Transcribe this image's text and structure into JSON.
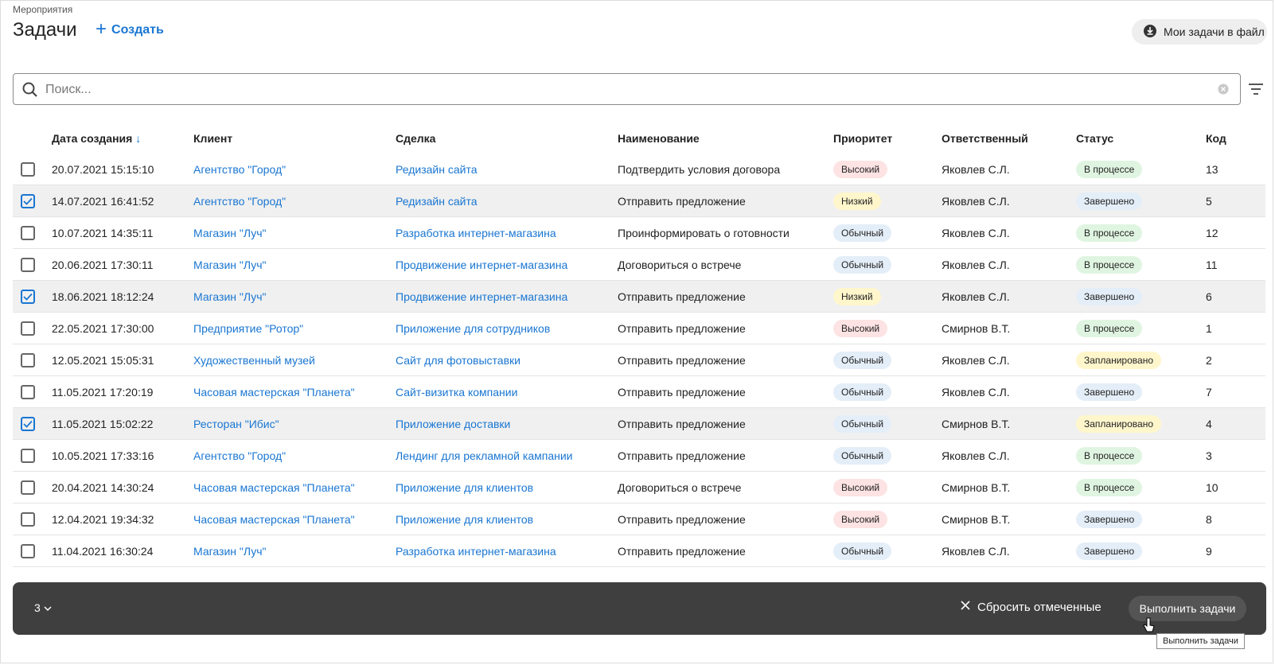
{
  "breadcrumb": "Мероприятия",
  "title": "Задачи",
  "create_label": "Создать",
  "export_label": "Мои задачи в файл",
  "search": {
    "placeholder": "Поиск..."
  },
  "colors": {
    "accent": "#1976d2",
    "bar": "#3f3f3f",
    "selected_row": "#f0f0f0"
  },
  "icons": [
    "plus-icon",
    "download-icon",
    "search-icon",
    "clear-icon",
    "filter-icon",
    "checkbox-icon",
    "sort-arrow-icon",
    "chevron-down-icon",
    "close-icon",
    "cursor-icon"
  ],
  "columns": {
    "date": "Дата создания",
    "date_sort": "↓",
    "client": "Клиент",
    "deal": "Сделка",
    "name": "Наименование",
    "priority": "Приоритет",
    "owner": "Ответственный",
    "status": "Статус",
    "code": "Код"
  },
  "rows": [
    {
      "checked": false,
      "date": "20.07.2021 15:15:10",
      "client": "Агентство \"Город\"",
      "deal": "Редизайн сайта",
      "name": "Подтвердить условия договора",
      "priority": "Высокий",
      "priority_type": "high",
      "owner": "Яковлев С.Л.",
      "status": "В процессе",
      "status_type": "progress",
      "code": "13"
    },
    {
      "checked": true,
      "date": "14.07.2021 16:41:52",
      "client": "Агентство \"Город\"",
      "deal": "Редизайн сайта",
      "name": "Отправить предложение",
      "priority": "Низкий",
      "priority_type": "low",
      "owner": "Яковлев С.Л.",
      "status": "Завершено",
      "status_type": "done",
      "code": "5"
    },
    {
      "checked": false,
      "date": "10.07.2021 14:35:11",
      "client": "Магазин \"Луч\"",
      "deal": "Разработка интернет-магазина",
      "name": "Проинформировать о готовности",
      "priority": "Обычный",
      "priority_type": "normal",
      "owner": "Яковлев С.Л.",
      "status": "В процессе",
      "status_type": "progress",
      "code": "12"
    },
    {
      "checked": false,
      "date": "20.06.2021 17:30:11",
      "client": "Магазин \"Луч\"",
      "deal": "Продвижение интернет-магазина",
      "name": "Договориться о встрече",
      "priority": "Обычный",
      "priority_type": "normal",
      "owner": "Яковлев С.Л.",
      "status": "В процессе",
      "status_type": "progress",
      "code": "11"
    },
    {
      "checked": true,
      "date": "18.06.2021 18:12:24",
      "client": "Магазин \"Луч\"",
      "deal": "Продвижение интернет-магазина",
      "name": "Отправить предложение",
      "priority": "Низкий",
      "priority_type": "low",
      "owner": "Яковлев С.Л.",
      "status": "Завершено",
      "status_type": "done",
      "code": "6"
    },
    {
      "checked": false,
      "date": "22.05.2021 17:30:00",
      "client": "Предприятие \"Ротор\"",
      "deal": "Приложение для сотрудников",
      "name": "Отправить предложение",
      "priority": "Высокий",
      "priority_type": "high",
      "owner": "Смирнов В.Т.",
      "status": "В процессе",
      "status_type": "progress",
      "code": "1"
    },
    {
      "checked": false,
      "date": "12.05.2021 15:05:31",
      "client": "Художественный музей",
      "deal": "Сайт для фотовыставки",
      "name": "Отправить предложение",
      "priority": "Обычный",
      "priority_type": "normal",
      "owner": "Яковлев С.Л.",
      "status": "Запланировано",
      "status_type": "plan",
      "code": "2"
    },
    {
      "checked": false,
      "date": "11.05.2021 17:20:19",
      "client": "Часовая мастерская \"Планета\"",
      "deal": "Сайт-визитка компании",
      "name": "Отправить предложение",
      "priority": "Обычный",
      "priority_type": "normal",
      "owner": "Яковлев С.Л.",
      "status": "Завершено",
      "status_type": "done",
      "code": "7"
    },
    {
      "checked": true,
      "date": "11.05.2021 15:02:22",
      "client": "Ресторан \"Ибис\"",
      "deal": "Приложение доставки",
      "name": "Отправить предложение",
      "priority": "Обычный",
      "priority_type": "normal",
      "owner": "Смирнов В.Т.",
      "status": "Запланировано",
      "status_type": "plan",
      "code": "4"
    },
    {
      "checked": false,
      "date": "10.05.2021 17:33:16",
      "client": "Агентство \"Город\"",
      "deal": "Лендинг для рекламной кампании",
      "name": "Отправить предложение",
      "priority": "Обычный",
      "priority_type": "normal",
      "owner": "Яковлев С.Л.",
      "status": "В процессе",
      "status_type": "progress",
      "code": "3"
    },
    {
      "checked": false,
      "date": "20.04.2021 14:30:24",
      "client": "Часовая мастерская \"Планета\"",
      "deal": "Приложение для клиентов",
      "name": "Договориться о встрече",
      "priority": "Высокий",
      "priority_type": "high",
      "owner": "Смирнов В.Т.",
      "status": "В процессе",
      "status_type": "progress",
      "code": "10"
    },
    {
      "checked": false,
      "date": "12.04.2021 19:34:32",
      "client": "Часовая мастерская \"Планета\"",
      "deal": "Приложение для клиентов",
      "name": "Отправить предложение",
      "priority": "Высокий",
      "priority_type": "high",
      "owner": "Смирнов В.Т.",
      "status": "Завершено",
      "status_type": "done",
      "code": "8"
    },
    {
      "checked": false,
      "date": "11.04.2021 16:30:24",
      "client": "Магазин \"Луч\"",
      "deal": "Разработка интернет-магазина",
      "name": "Отправить предложение",
      "priority": "Обычный",
      "priority_type": "normal",
      "owner": "Яковлев С.Л.",
      "status": "Завершено",
      "status_type": "done",
      "code": "9"
    }
  ],
  "bottom_bar": {
    "selected_count": "3",
    "reset_label": "Сбросить отмеченные",
    "execute_label": "Выполнить задачи",
    "tooltip": "Выполнить задачи"
  }
}
